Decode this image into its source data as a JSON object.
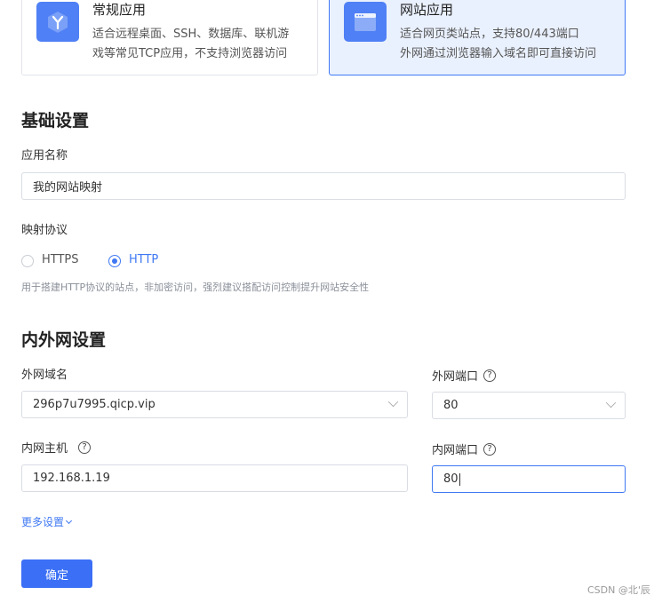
{
  "app_types": [
    {
      "title": "常规应用",
      "desc_line1": "适合远程桌面、SSH、数据库、联机游",
      "desc_line2": "戏等常见TCP应用，不支持浏览器访问",
      "icon": "y-logo-icon",
      "selected": false
    },
    {
      "title": "网站应用",
      "desc_line1": "适合网页类站点，支持80/443端口",
      "desc_line2": "外网通过浏览器输入域名即可直接访问",
      "icon": "browser-window-icon",
      "selected": true
    }
  ],
  "basic_settings": {
    "title": "基础设置",
    "app_name_label": "应用名称",
    "app_name_value": "我的网站映射",
    "protocol_label": "映射协议",
    "protocol_options": [
      "HTTPS",
      "HTTP"
    ],
    "protocol_selected": "HTTP",
    "protocol_hint": "用于搭建HTTP协议的站点，非加密访问，强烈建议搭配访问控制提升网站安全性"
  },
  "network_settings": {
    "title": "内外网设置",
    "external_domain_label": "外网域名",
    "external_domain_value": "296p7u7995.qicp.vip",
    "external_port_label": "外网端口",
    "external_port_value": "80",
    "internal_host_label": "内网主机",
    "internal_host_value": "192.168.1.19",
    "internal_port_label": "内网端口",
    "internal_port_value": "80"
  },
  "more_settings_label": "更多设置",
  "confirm_label": "确定",
  "watermark": "CSDN @北'辰",
  "colors": {
    "accent": "#3f78f3",
    "primary_button": "#3b6ff5",
    "selected_card_bg": "#eaf1fe",
    "icon_bg": "#4f80f5"
  }
}
